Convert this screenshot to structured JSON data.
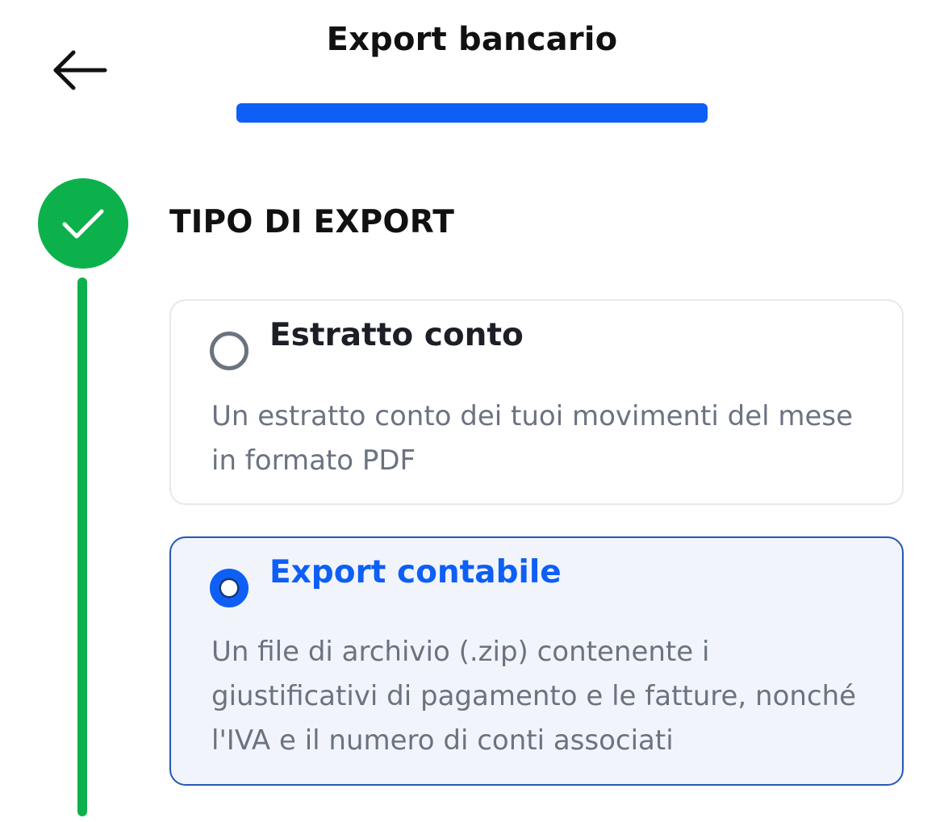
{
  "header": {
    "title": "Export bancario",
    "back_icon": "arrow-left-icon"
  },
  "progress": {
    "value": 1.0,
    "color": "#0d5ff5"
  },
  "step": {
    "status_icon": "checkmark-icon",
    "status": "completed",
    "color": "#0db14b",
    "title": "TIPO DI EXPORT"
  },
  "options": [
    {
      "label": "Estratto conto",
      "description": "Un estratto conto dei tuoi movimenti del mese in formato PDF",
      "selected": false
    },
    {
      "label": "Export contabile",
      "description": "Un file di archivio (.zip) contenente i giustificativi di pagamento e le fatture, nonché l'IVA e il numero di conti associati",
      "selected": true
    }
  ]
}
